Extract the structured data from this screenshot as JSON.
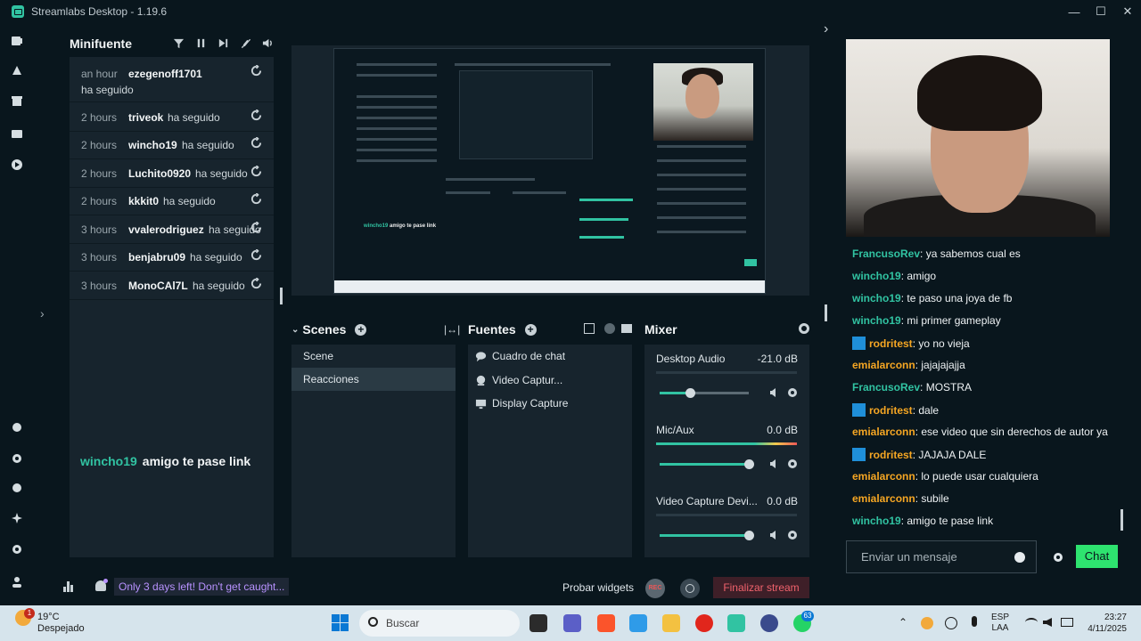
{
  "window": {
    "title": "Streamlabs Desktop - 1.19.6"
  },
  "events": {
    "title": "Minifuente",
    "items": [
      {
        "time": "an hour",
        "user": "ezegenoff1701",
        "action": "ha seguido"
      },
      {
        "time": "2 hours",
        "user": "triveok",
        "action": "ha seguido"
      },
      {
        "time": "2 hours",
        "user": "wincho19",
        "action": "ha seguido"
      },
      {
        "time": "2 hours",
        "user": "Luchito0920",
        "action": "ha seguido"
      },
      {
        "time": "2 hours",
        "user": "kkkit0",
        "action": "ha seguido"
      },
      {
        "time": "3 hours",
        "user": "vvalerodriguez",
        "action": "ha seguido"
      },
      {
        "time": "3 hours",
        "user": "benjabru09",
        "action": "ha seguido"
      },
      {
        "time": "3 hours",
        "user": "MonoCAl7L",
        "action": "ha seguido"
      }
    ],
    "overlay": {
      "user": "wincho19",
      "message": "amigo te pase link"
    }
  },
  "scenes": {
    "title": "Scenes",
    "items": [
      "Scene",
      "Reacciones"
    ],
    "selected": "Reacciones"
  },
  "sources": {
    "title": "Fuentes",
    "items": [
      "Cuadro de chat",
      "Video Captur...",
      "Display Capture"
    ]
  },
  "mixer": {
    "title": "Mixer",
    "channels": [
      {
        "name": "Desktop Audio",
        "db": "-21.0 dB",
        "level": 0.34,
        "meter": 0.0
      },
      {
        "name": "Mic/Aux",
        "db": "0.0 dB",
        "level": 1.0,
        "meter": 1.0
      },
      {
        "name": "Video Capture Devi...",
        "db": "0.0 dB",
        "level": 1.0,
        "meter": 0.0
      }
    ]
  },
  "statusbar": {
    "promo": "Only 3 days left! Don't get caught...",
    "probar": "Probar widgets",
    "rec": "REC",
    "finalize": "Finalizar stream"
  },
  "chat": {
    "messages": [
      {
        "user": "FrancusoRev",
        "text": "ya sabemos cual es",
        "color": "#31c3a2",
        "mod": false
      },
      {
        "user": "wincho19",
        "text": "amigo",
        "color": "#31c3a2",
        "mod": false
      },
      {
        "user": "wincho19",
        "text": "te paso una joya de fb",
        "color": "#31c3a2",
        "mod": false
      },
      {
        "user": "wincho19",
        "text": "mi primer gameplay",
        "color": "#31c3a2",
        "mod": false
      },
      {
        "user": "rodritest",
        "text": "yo no vieja",
        "color": "#f5a623",
        "mod": true
      },
      {
        "user": "emialarconn",
        "text": "jajajajajja",
        "color": "#f5a623",
        "mod": false
      },
      {
        "user": "FrancusoRev",
        "text": "MOSTRA",
        "color": "#31c3a2",
        "mod": false
      },
      {
        "user": "rodritest",
        "text": "dale",
        "color": "#f5a623",
        "mod": true
      },
      {
        "user": "emialarconn",
        "text": "ese video que sin derechos de autor ya",
        "color": "#f5a623",
        "mod": false
      },
      {
        "user": "rodritest",
        "text": "JAJAJA DALE",
        "color": "#f5a623",
        "mod": true
      },
      {
        "user": "emialarconn",
        "text": "lo puede usar cualquiera",
        "color": "#f5a623",
        "mod": false
      },
      {
        "user": "emialarconn",
        "text": "subile",
        "color": "#f5a623",
        "mod": false
      },
      {
        "user": "wincho19",
        "text": "amigo te pase link",
        "color": "#31c3a2",
        "mod": false
      }
    ],
    "input_placeholder": "Enviar un mensaje",
    "send_label": "Chat"
  },
  "taskbar": {
    "weather_temp": "19°C",
    "weather_desc": "Despejado",
    "weather_badge": "1",
    "search": "Buscar",
    "lang": "ESP",
    "region": "LAA",
    "time": "23:27",
    "date": "4/11/2025",
    "whatsapp_badge": "63"
  },
  "colors": {
    "accent": "#31c3a2",
    "chat_button": "#2ee36f",
    "finalize": "#f0626c",
    "promo": "#b892ff"
  }
}
